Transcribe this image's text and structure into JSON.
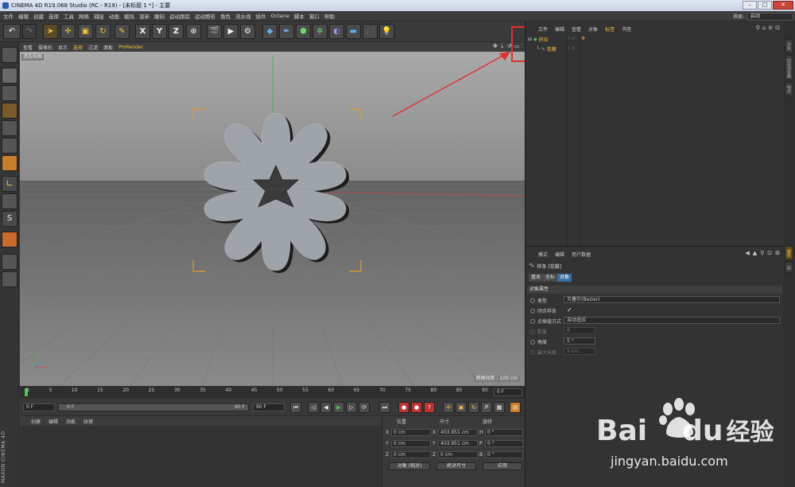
{
  "window": {
    "title": "CINEMA 4D R19.068 Studio (RC - R19) - [未标题 1 *] - 主要"
  },
  "menubar": [
    "文件",
    "编辑",
    "创建",
    "选择",
    "工具",
    "网格",
    "捕捉",
    "动画",
    "模拟",
    "渲染",
    "雕刻",
    "运动跟踪",
    "运动图形",
    "角色",
    "流水线",
    "插件",
    "Octane",
    "脚本",
    "窗口",
    "帮助"
  ],
  "layout": {
    "label": "界面:",
    "value": "启动"
  },
  "viewport": {
    "menu": [
      "查看",
      "摄像机",
      "显示",
      "选项",
      "过滤",
      "面板",
      "ProRender"
    ],
    "label": "透视视图",
    "grid_spacing": "网格间距 : 100 cm"
  },
  "timeline": {
    "ticks": [
      "0",
      "5",
      "10",
      "15",
      "20",
      "25",
      "30",
      "35",
      "40",
      "45",
      "50",
      "55",
      "60",
      "65",
      "70",
      "75",
      "80",
      "85",
      "90"
    ],
    "frame_end_label": "0 F"
  },
  "playback": {
    "start": "0 F",
    "current": "0 F",
    "slider_end": "90 F",
    "end": "90 F"
  },
  "material": {
    "tabs": [
      "创建",
      "编辑",
      "功能",
      "纹理"
    ]
  },
  "coordinates": {
    "headers": [
      "位置",
      "尺寸",
      "旋转"
    ],
    "rows": [
      {
        "axis": "X",
        "pos": "0 cm",
        "size": "403.951 cm",
        "rot_label": "H",
        "rot": "0 °"
      },
      {
        "axis": "Y",
        "pos": "0 cm",
        "size": "403.951 cm",
        "rot_label": "P",
        "rot": "0 °"
      },
      {
        "axis": "Z",
        "pos": "0 cm",
        "size": "0 cm",
        "rot_label": "B",
        "rot": "0 °"
      }
    ],
    "mode": "对象 (相对)",
    "size_mode": "绝对尺寸",
    "apply": "应用"
  },
  "objects": {
    "menu": [
      "文件",
      "编辑",
      "查看",
      "对象",
      "标签",
      "书签"
    ],
    "items": [
      {
        "name": "挤压",
        "level": 0
      },
      {
        "name": "花瓣",
        "level": 1
      }
    ]
  },
  "attributes": {
    "menu": [
      "模式",
      "编辑",
      "用户数据"
    ],
    "title": "样条 [花瓣]",
    "tabs": [
      "基本",
      "坐标",
      "对象"
    ],
    "active_tab": 2,
    "section": "对象属性",
    "rows": [
      {
        "label": "类型",
        "value": "贝塞尔(Bezier)",
        "type": "dropdown"
      },
      {
        "label": "闭合样条",
        "value": "✓",
        "type": "check"
      },
      {
        "label": "点插值方式",
        "value": "自动适应",
        "type": "dropdown"
      },
      {
        "label": "数量",
        "value": "8",
        "type": "disabled"
      },
      {
        "label": "角度",
        "value": "5 °",
        "type": "field"
      },
      {
        "label": "最大长度",
        "value": "5 cm",
        "type": "disabled"
      }
    ]
  },
  "right_strip": [
    "对象",
    "内容浏览器",
    "构造",
    "属性",
    "层"
  ],
  "watermark": {
    "brand": "Bai",
    "brand_du": "du",
    "cn": "经验",
    "url": "jingyan.baidu.com"
  },
  "colors": {
    "accent": "#f2c243",
    "highlight_box": "#e03030",
    "selection_blue": "#3b6fa3"
  }
}
